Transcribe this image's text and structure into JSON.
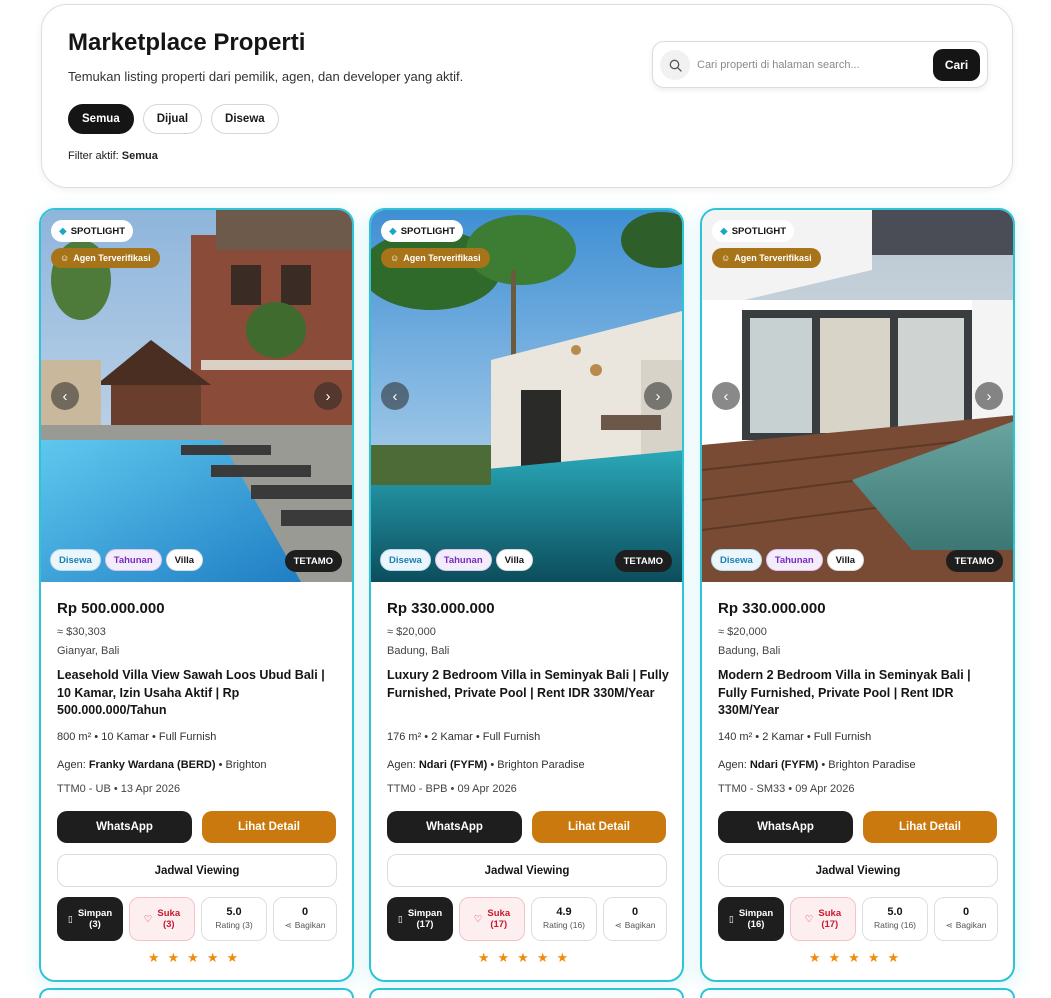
{
  "header": {
    "title": "Marketplace Properti",
    "subtitle": "Temukan listing properti dari pemilik, agen, dan developer yang aktif.",
    "filters": [
      "Semua",
      "Dijual",
      "Disewa"
    ],
    "active_filter_label": "Filter aktif:",
    "active_filter_value": "Semua",
    "search": {
      "placeholder": "Cari properti di halaman search...",
      "button": "Cari"
    }
  },
  "cards": [
    {
      "spotlight": "SPOTLIGHT",
      "agent_badge": "Agen Terverifikasi",
      "tags": [
        "Disewa",
        "Tahunan",
        "Villa"
      ],
      "code": "TETAMO",
      "price": "Rp 500.000.000",
      "usd": "≈ $30,303",
      "location": "Gianyar, Bali",
      "title": "Leasehold Villa View Sawah Loos Ubud Bali | 10 Kamar, Izin Usaha Aktif | Rp 500.000.000/Tahun",
      "specs": "800 m² • 10 Kamar • Full Furnish",
      "agent_label": "Agen:",
      "agent_name": "Franky Wardana (BERD)",
      "agency": "• Brighton",
      "meta": "TTM0 - UB  •  13 Apr 2026",
      "btn_wa": "WhatsApp",
      "btn_detail": "Lihat Detail",
      "btn_view": "Jadwal Viewing",
      "save_label": "Simpan",
      "save_count": "(3)",
      "like_label": "Suka",
      "like_count": "(3)",
      "rating": "5.0",
      "rating_label": "Rating (3)",
      "share_count": "0",
      "share_label": "Bagikan",
      "stars": "★★★★★"
    },
    {
      "spotlight": "SPOTLIGHT",
      "agent_badge": "Agen Terverifikasi",
      "tags": [
        "Disewa",
        "Tahunan",
        "Villa"
      ],
      "code": "TETAMO",
      "price": "Rp 330.000.000",
      "usd": "≈ $20,000",
      "location": "Badung, Bali",
      "title": "Luxury 2 Bedroom Villa in Seminyak Bali | Fully Furnished, Private Pool | Rent IDR 330M/Year",
      "specs": "176 m² • 2 Kamar • Full Furnish",
      "agent_label": "Agen:",
      "agent_name": "Ndari (FYFM)",
      "agency": "• Brighton Paradise",
      "meta": "TTM0 - BPB  •  09 Apr 2026",
      "btn_wa": "WhatsApp",
      "btn_detail": "Lihat Detail",
      "btn_view": "Jadwal Viewing",
      "save_label": "Simpan",
      "save_count": "(17)",
      "like_label": "Suka",
      "like_count": "(17)",
      "rating": "4.9",
      "rating_label": "Rating (16)",
      "share_count": "0",
      "share_label": "Bagikan",
      "stars": "★★★★★"
    },
    {
      "spotlight": "SPOTLIGHT",
      "agent_badge": "Agen Terverifikasi",
      "tags": [
        "Disewa",
        "Tahunan",
        "Villa"
      ],
      "code": "TETAMO",
      "price": "Rp 330.000.000",
      "usd": "≈ $20,000",
      "location": "Badung, Bali",
      "title": "Modern 2 Bedroom Villa in Seminyak Bali | Fully Furnished, Private Pool | Rent IDR 330M/Year",
      "specs": "140 m² • 2 Kamar • Full Furnish",
      "agent_label": "Agen:",
      "agent_name": "Ndari (FYFM)",
      "agency": "• Brighton Paradise",
      "meta": "TTM0 - SM33  •  09 Apr 2026",
      "btn_wa": "WhatsApp",
      "btn_detail": "Lihat Detail",
      "btn_view": "Jadwal Viewing",
      "save_label": "Simpan",
      "save_count": "(16)",
      "like_label": "Suka",
      "like_count": "(17)",
      "rating": "5.0",
      "rating_label": "Rating (16)",
      "share_count": "0",
      "share_label": "Bagikan",
      "stars": "★★★★★"
    }
  ],
  "colors": {
    "accent_border": "#2ec4d6",
    "detail_button": "#c9790d",
    "agent_badge": "#a8741a",
    "like": "#c8192e",
    "star": "#f08c0c"
  },
  "icons": [
    "search-icon",
    "gem-icon",
    "verified-agent-icon",
    "chevron-left-icon",
    "chevron-right-icon",
    "bookmark-icon",
    "heart-icon",
    "share-icon",
    "star-icon"
  ]
}
